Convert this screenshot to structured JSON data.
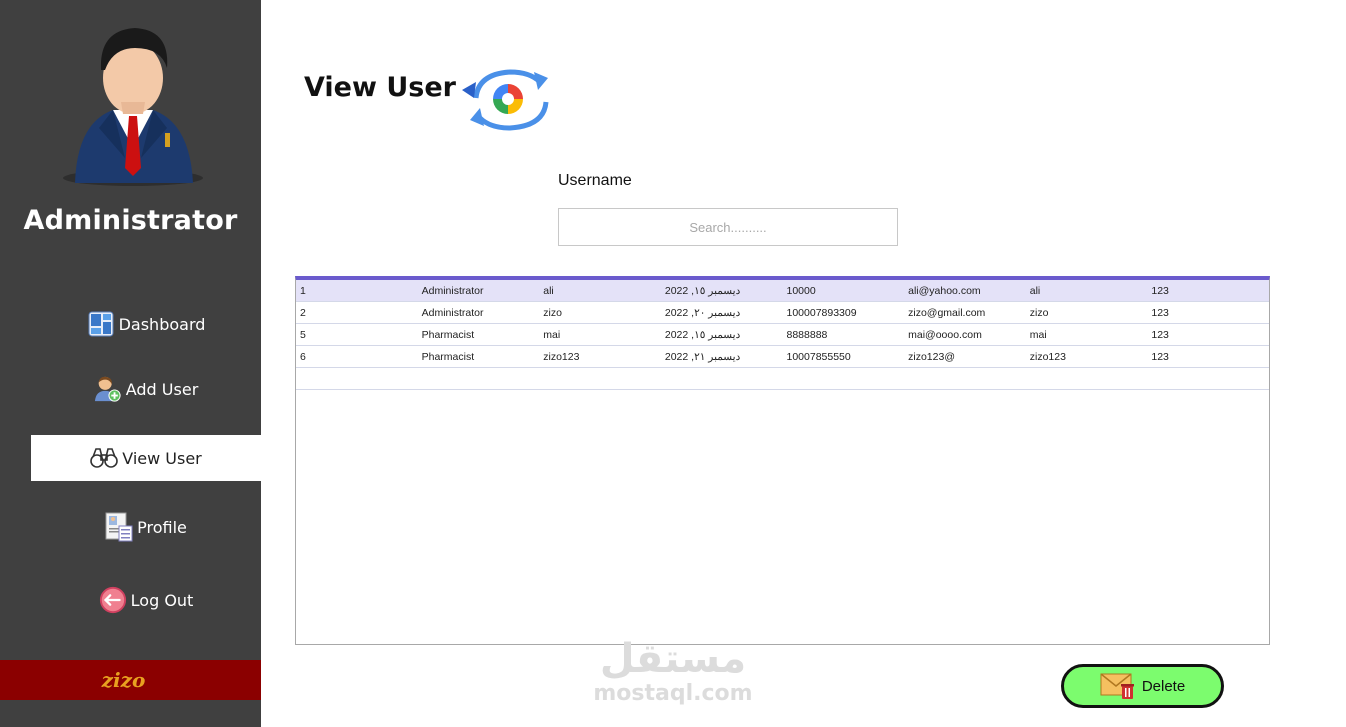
{
  "sidebar": {
    "role_title": "Administrator",
    "items": [
      {
        "label": "Dashboard",
        "icon": "dashboard-icon",
        "active": false
      },
      {
        "label": "Add User",
        "icon": "add-user-icon",
        "active": false
      },
      {
        "label": "View User",
        "icon": "binoculars-icon",
        "active": true
      },
      {
        "label": "Profile",
        "icon": "profile-icon",
        "active": false
      },
      {
        "label": "Log Out",
        "icon": "logout-icon",
        "active": false
      }
    ],
    "current_user": "zizo"
  },
  "main": {
    "title": "View User",
    "search": {
      "label": "Username",
      "placeholder": "Search..........",
      "value": ""
    },
    "table": {
      "rows": [
        [
          "1",
          "Administrator",
          "ali",
          "ديسمبر ١٥, 2022",
          "10000",
          "ali@yahoo.com",
          "ali",
          "123"
        ],
        [
          "2",
          "Administrator",
          "zizo",
          "ديسمبر ٢٠, 2022",
          "100007893309",
          "zizo@gmail.com",
          "zizo",
          "123"
        ],
        [
          "5",
          "Pharmacist",
          "mai",
          "ديسمبر ١٥, 2022",
          "8888888",
          "mai@oooo.com",
          "mai",
          "123"
        ],
        [
          "6",
          "Pharmacist",
          "zizo123",
          "ديسمبر ٢١, 2022",
          "10007855550",
          "zizo123@",
          "zizo123",
          "123"
        ]
      ],
      "selected_row": 0
    },
    "delete_label": "Delete"
  },
  "watermark": {
    "arabic": "مستقل",
    "latin": "mostaql.com"
  },
  "colors": {
    "sidebar_bg": "#404040",
    "user_bar_bg": "#8b0000",
    "user_bar_text": "#e8a020",
    "table_accent": "#6a5acd",
    "delete_bg": "#7cfc6e"
  }
}
